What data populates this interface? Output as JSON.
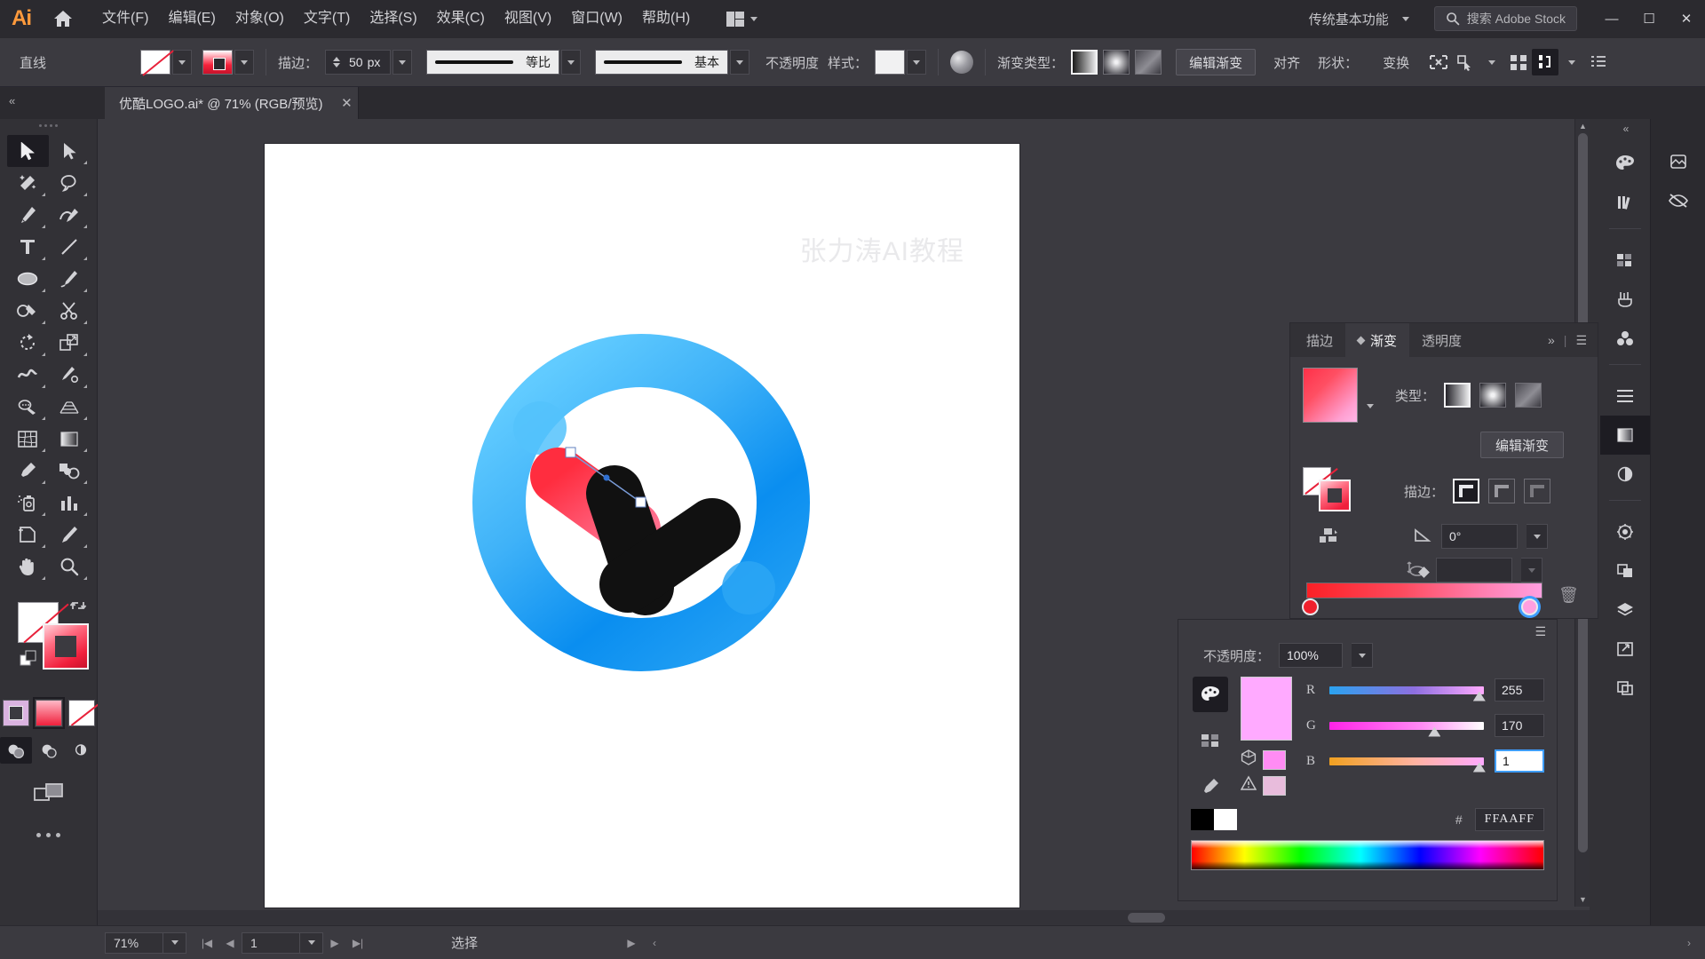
{
  "app": {
    "logo": "Ai",
    "workspace": "传统基本功能",
    "stock_search_placeholder": "搜索 Adobe Stock",
    "home_icon": "home-icon",
    "arrange_icon": "arrange-documents-icon",
    "window_controls": {
      "minimize": "—",
      "maximize": "☐",
      "close": "✕"
    }
  },
  "menu": {
    "items": [
      {
        "label": "文件(F)"
      },
      {
        "label": "编辑(E)"
      },
      {
        "label": "对象(O)"
      },
      {
        "label": "文字(T)"
      },
      {
        "label": "选择(S)"
      },
      {
        "label": "效果(C)"
      },
      {
        "label": "视图(V)"
      },
      {
        "label": "窗口(W)"
      },
      {
        "label": "帮助(H)"
      }
    ]
  },
  "control_bar": {
    "tool_label": "直线",
    "fill_swatch": "none-swatch",
    "stroke_swatch": "gradient-swatch",
    "stroke_label": "描边：",
    "stroke_weight": "50",
    "stroke_unit": "px",
    "stroke_profile_label": "等比",
    "brush_label": "基本",
    "opacity_label": "不透明度",
    "style_label": "样式：",
    "gradient_type_label": "渐变类型：",
    "edit_gradient": "编辑渐变",
    "align_label": "对齐",
    "shape_label": "形状：",
    "transform_label": "变换",
    "icons": [
      "isolate-icon",
      "select-similar-icon",
      "arrange-icon",
      "align-icon",
      "panel-options-icon"
    ]
  },
  "document_tab": {
    "title": "优酷LOGO.ai* @ 71% (RGB/预览)",
    "close_icon": "close-icon"
  },
  "toolbar": {
    "tools": [
      {
        "name": "selection-tool",
        "selected": true
      },
      {
        "name": "direct-selection-tool",
        "selected": false
      },
      {
        "name": "magic-wand-tool",
        "selected": false
      },
      {
        "name": "lasso-tool",
        "selected": false
      },
      {
        "name": "pen-tool",
        "selected": false
      },
      {
        "name": "curvature-tool",
        "selected": false
      },
      {
        "name": "type-tool",
        "selected": false
      },
      {
        "name": "line-segment-tool",
        "selected": false
      },
      {
        "name": "ellipse-tool",
        "selected": false
      },
      {
        "name": "paintbrush-tool",
        "selected": false
      },
      {
        "name": "shaper-tool",
        "selected": false
      },
      {
        "name": "scissors-tool",
        "selected": false
      },
      {
        "name": "rotate-tool",
        "selected": false
      },
      {
        "name": "scale-tool",
        "selected": false
      },
      {
        "name": "width-tool",
        "selected": false
      },
      {
        "name": "free-transform-tool",
        "selected": false
      },
      {
        "name": "shape-builder-tool",
        "selected": false
      },
      {
        "name": "perspective-grid-tool",
        "selected": false
      },
      {
        "name": "mesh-tool",
        "selected": false
      },
      {
        "name": "gradient-tool",
        "selected": false
      },
      {
        "name": "eyedropper-tool",
        "selected": false
      },
      {
        "name": "blend-tool",
        "selected": false
      },
      {
        "name": "symbol-sprayer-tool",
        "selected": false
      },
      {
        "name": "column-graph-tool",
        "selected": false
      },
      {
        "name": "artboard-tool",
        "selected": false
      },
      {
        "name": "slice-tool",
        "selected": false
      },
      {
        "name": "hand-tool",
        "selected": false
      },
      {
        "name": "zoom-tool",
        "selected": false
      }
    ],
    "fill_stroke": {
      "fill": "none-swatch",
      "stroke": "gradient-swatch",
      "swap_icon": "swap-fill-stroke-icon",
      "default_icon": "default-fill-stroke-icon"
    },
    "color_modes": [
      "color-swatch-mode",
      "gradient-mode",
      "none-mode"
    ],
    "draw_modes": [
      "draw-normal",
      "draw-behind",
      "draw-inside"
    ],
    "screen_mode": "change-screen-mode-icon",
    "more_tools": "more-tools-icon"
  },
  "canvas": {
    "watermark": "张力涛AI教程",
    "artboard_bg": "#ffffff",
    "logo": {
      "ring_outer": "#35b0f5",
      "ring_light": "#5ec9ff",
      "arrow_red": "#f6263c",
      "arrow_black": "#111111",
      "accent_blue": "#49b6f7"
    }
  },
  "gradient_panel": {
    "tabs": [
      {
        "label": "描边",
        "selected": false
      },
      {
        "label": "渐变",
        "selected": true
      },
      {
        "label": "透明度",
        "selected": false
      }
    ],
    "expand_icon": "expand-panel-icon",
    "menu_icon": "panel-menu-icon",
    "type_label": "类型：",
    "types": [
      "linear-gradient",
      "radial-gradient",
      "freeform-gradient"
    ],
    "selected_type": "linear-gradient",
    "edit_gradient_button": "编辑渐变",
    "stroke_label": "描边：",
    "stroke_options": [
      "apply-within-stroke",
      "apply-along-stroke",
      "apply-across-stroke"
    ],
    "angle_label": "angle-icon",
    "angle_value": "0°",
    "aspect_icon": "aspect-ratio-icon",
    "aspect_value": "",
    "delete_stop_icon": "delete-stop-icon",
    "stops": [
      {
        "position": 0,
        "color": "#f0202c"
      },
      {
        "position": 100,
        "color": "#ff9fe0"
      }
    ],
    "midpoint": 50
  },
  "color_panel": {
    "menu_icon": "panel-menu-icon",
    "opacity_label": "不透明度：",
    "opacity_value": "100%",
    "color_mixer_icon": "color-mixer-icon",
    "swatch_icon": "swatches-icon",
    "eyedropper_icon": "eyedropper-icon",
    "current_color": "#FFAAFF",
    "channels": [
      {
        "label": "R",
        "value": "255",
        "percent": 95,
        "editing": false
      },
      {
        "label": "G",
        "value": "170",
        "percent": 67,
        "editing": false
      },
      {
        "label": "B",
        "value": "1",
        "percent": 95,
        "editing": true
      }
    ],
    "out_of_gamut_icon": "out-of-gamut-icon",
    "out_of_web_icon": "out-of-web-icon",
    "gamut_swatch": "#ff8cf4",
    "web_swatch": "#e8bcdc",
    "hex_symbol": "#",
    "hex_value": "FFAAFF",
    "black_swatch": "#000000",
    "white_swatch": "#ffffff"
  },
  "status_bar": {
    "zoom": "71%",
    "page": "1",
    "status_text": "选择",
    "nav_first": "first-artboard-icon",
    "nav_prev": "prev-artboard-icon",
    "nav_next": "next-artboard-icon",
    "nav_last": "last-artboard-icon"
  },
  "right_dock": {
    "items": [
      "color-panel-icon",
      "libraries-icon",
      "brushes-icon",
      "symbols-icon",
      "properties-icon",
      "swatches-icon",
      "layers-icon",
      "artboards-icon",
      "appearance-icon",
      "graphic-styles-icon",
      "transform-icon",
      "pathfinder-icon",
      "align-panel-icon",
      "links-icon",
      "export-icon",
      "asset-export-icon"
    ]
  }
}
